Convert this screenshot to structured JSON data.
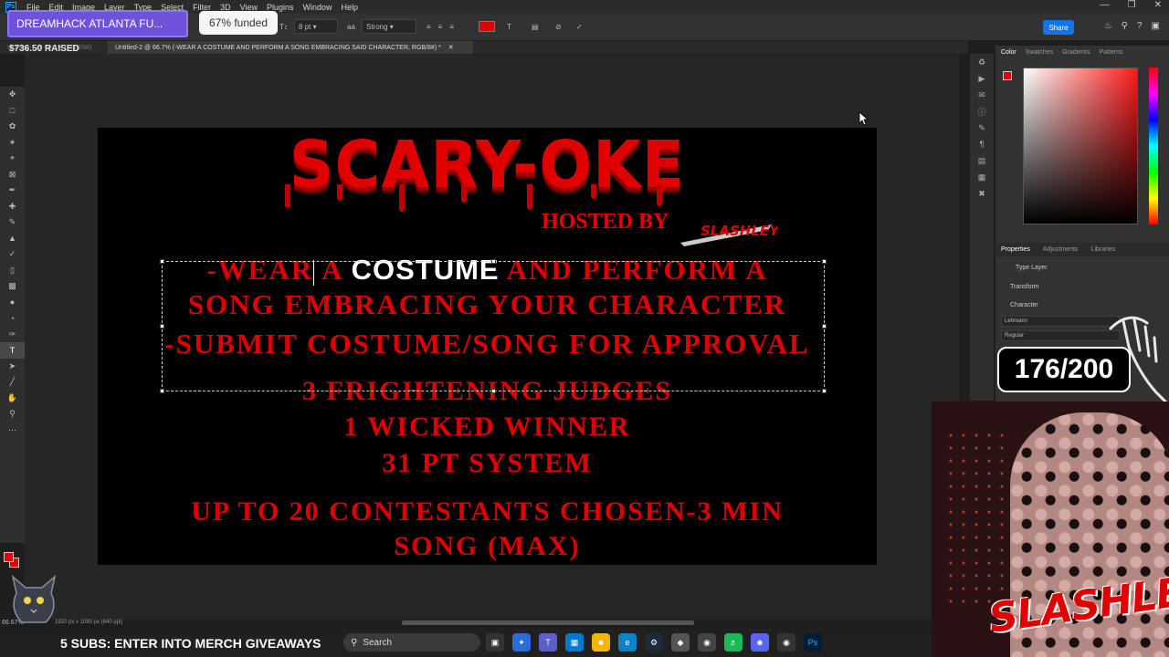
{
  "app": {
    "menu": [
      "File",
      "Edit",
      "Image",
      "Layer",
      "Type",
      "Select",
      "Filter",
      "3D",
      "View",
      "Plugins",
      "Window",
      "Help"
    ],
    "logo": "Ps"
  },
  "options": {
    "font_size": "8 pt",
    "antialias": "Strong",
    "share_label": "Share",
    "text_color": "#e00000"
  },
  "overlay": {
    "donation_title": "DREAMHACK ATLANTA FU...",
    "funded": "67% funded",
    "raised": "$736.50 RAISED",
    "counter": "176/200",
    "ticker": "5 SUBS: ENTER INTO MERCH GIVEAWAYS"
  },
  "document": {
    "tab_inactive": "Untitled-1 @ 66.7% (RGB/8#)",
    "tab_active": "Untitled-2 @ 66.7% (-WEAR A COSTUME AND PERFORM A SONG EMBRACING SAID CHARACTER, RGB/8#) *",
    "zoom": "66.67%",
    "status": "1920 px x 1080 px (640 ppi)"
  },
  "canvas": {
    "title": "SCARY-OKE",
    "hosted_by": "HOSTED BY",
    "host_logo": "SLASHLEY",
    "line1_a": "-WEAR",
    "line1_b": "A",
    "line1_sel": "COSTUME",
    "line1_c": "AND PERFORM A",
    "line2": "SONG EMBRACING YOUR CHARACTER",
    "line3": "-SUBMIT COSTUME/SONG FOR APPROVAL",
    "line4": "3 FRIGHTENING JUDGES",
    "line5": "1 WICKED WINNER",
    "line6": "31 PT  SYSTEM",
    "line7": "UP TO 20 CONTESTANTS CHOSEN-3 MIN",
    "line8": "SONG (MAX)"
  },
  "panels": {
    "color_tabs": [
      "Color",
      "Swatches",
      "Gradients",
      "Patterns"
    ],
    "props_tabs": [
      "Properties",
      "Adjustments",
      "Libraries"
    ],
    "type_layer": "Type Layer",
    "transform": "Transform",
    "character": "Character",
    "font_family": "Lehmann",
    "font_style": "Regular"
  },
  "taskbar": {
    "search_placeholder": "Search"
  },
  "webcam": {
    "logo": "SLASHLEY"
  },
  "colors": {
    "accent": "#e00000",
    "banner": "#6f52d9",
    "share": "#1473e6"
  }
}
